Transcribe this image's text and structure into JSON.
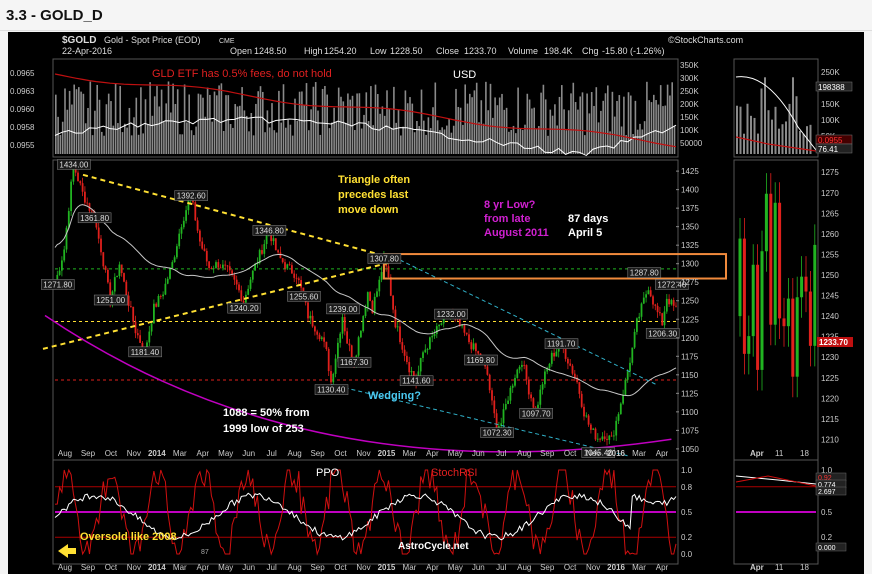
{
  "page_title": "3.3 - GOLD_D",
  "chart_data": {
    "type": "candlestick",
    "symbol": "$GOLD",
    "instrument": "Gold - Spot Price (EOD)",
    "exchange": "CME",
    "source": "©StockCharts.com",
    "date": "22-Apr-2016",
    "quote": {
      "open": "1248.50",
      "high": "1254.20",
      "low": "1228.50",
      "close": "1233.70",
      "volume": "198.4K",
      "chg": "-15.80 (-1.26%)"
    },
    "quote_labels": {
      "open": "Open",
      "high": "High",
      "low": "Low",
      "close": "Close",
      "volume": "Volume",
      "chg": "Chg"
    },
    "top_panel": {
      "label": "USD",
      "annotation": "GLD ETF has 0.5% fees, do not hold",
      "left_ticks": [
        "0.0965",
        "0.0963",
        "0.0960",
        "0.0958",
        "0.0955"
      ],
      "right_ticks": [
        "350K",
        "300K",
        "250K",
        "200K",
        "150K",
        "100K",
        "50000"
      ]
    },
    "price_axis": {
      "ylim": [
        1035,
        1440
      ],
      "ticks": [
        1050,
        1075,
        1100,
        1125,
        1150,
        1175,
        1200,
        1225,
        1250,
        1275,
        1300,
        1325,
        1350,
        1375,
        1400,
        1425
      ]
    },
    "months_axis": [
      "Aug",
      "Sep",
      "Oct",
      "Nov",
      "2014",
      "Mar",
      "Apr",
      "May",
      "Jun",
      "Jul",
      "Aug",
      "Sep",
      "Oct",
      "Nov",
      "2015",
      "Mar",
      "Apr",
      "May",
      "Jun",
      "Jul",
      "Aug",
      "Sep",
      "Oct",
      "Nov",
      "2016",
      "Mar",
      "Apr"
    ],
    "close_path": [
      [
        0,
        1272
      ],
      [
        4,
        1320
      ],
      [
        8,
        1434
      ],
      [
        12,
        1395
      ],
      [
        17,
        1362
      ],
      [
        20,
        1320
      ],
      [
        24,
        1251
      ],
      [
        28,
        1300
      ],
      [
        31,
        1260
      ],
      [
        35,
        1210
      ],
      [
        39,
        1181
      ],
      [
        43,
        1240
      ],
      [
        47,
        1262
      ],
      [
        51,
        1300
      ],
      [
        55,
        1355
      ],
      [
        59,
        1392
      ],
      [
        63,
        1330
      ],
      [
        67,
        1295
      ],
      [
        71,
        1300
      ],
      [
        75,
        1290
      ],
      [
        79,
        1270
      ],
      [
        82,
        1250
      ],
      [
        85,
        1280
      ],
      [
        89,
        1312
      ],
      [
        93,
        1345
      ],
      [
        97,
        1310
      ],
      [
        101,
        1295
      ],
      [
        105,
        1285
      ],
      [
        108,
        1255
      ],
      [
        110,
        1230
      ],
      [
        113,
        1215
      ],
      [
        116,
        1200
      ],
      [
        118,
        1180
      ],
      [
        120,
        1140
      ],
      [
        122,
        1175
      ],
      [
        125,
        1230
      ],
      [
        127,
        1195
      ],
      [
        130,
        1167
      ],
      [
        133,
        1215
      ],
      [
        136,
        1262
      ],
      [
        138,
        1240
      ],
      [
        141,
        1275
      ],
      [
        143,
        1307
      ],
      [
        145,
        1280
      ],
      [
        148,
        1220
      ],
      [
        151,
        1190
      ],
      [
        154,
        1160
      ],
      [
        157,
        1141
      ],
      [
        160,
        1180
      ],
      [
        164,
        1200
      ],
      [
        168,
        1220
      ],
      [
        172,
        1232
      ],
      [
        176,
        1215
      ],
      [
        180,
        1195
      ],
      [
        185,
        1172
      ],
      [
        188,
        1150
      ],
      [
        190,
        1110
      ],
      [
        192,
        1080
      ],
      [
        194,
        1085
      ],
      [
        197,
        1120
      ],
      [
        200,
        1150
      ],
      [
        203,
        1170
      ],
      [
        206,
        1130
      ],
      [
        209,
        1100
      ],
      [
        212,
        1140
      ],
      [
        216,
        1175
      ],
      [
        220,
        1192
      ],
      [
        223,
        1170
      ],
      [
        227,
        1140
      ],
      [
        230,
        1100
      ],
      [
        233,
        1075
      ],
      [
        236,
        1065
      ],
      [
        239,
        1070
      ],
      [
        242,
        1062
      ],
      [
        245,
        1100
      ],
      [
        248,
        1140
      ],
      [
        251,
        1185
      ],
      [
        253,
        1220
      ],
      [
        256,
        1250
      ],
      [
        258,
        1270
      ],
      [
        261,
        1240
      ],
      [
        264,
        1220
      ],
      [
        266,
        1255
      ],
      [
        268,
        1245
      ],
      [
        270,
        1238
      ]
    ],
    "annotations": [
      {
        "text": "1434.00",
        "x": 8,
        "y": 1434
      },
      {
        "text": "1361.80",
        "x": 17,
        "y": 1362
      },
      {
        "text": "1392.60",
        "x": 59,
        "y": 1392
      },
      {
        "text": "1346.80",
        "x": 93,
        "y": 1345
      },
      {
        "text": "1271.80",
        "x": 1,
        "y": 1272
      },
      {
        "text": "1251.00",
        "x": 24,
        "y": 1251
      },
      {
        "text": "1240.20",
        "x": 82,
        "y": 1240
      },
      {
        "text": "1181.40",
        "x": 39,
        "y": 1181
      },
      {
        "text": "1255.60",
        "x": 108,
        "y": 1256
      },
      {
        "text": "1239.00",
        "x": 125,
        "y": 1239
      },
      {
        "text": "1307.80",
        "x": 143,
        "y": 1307
      },
      {
        "text": "1232.00",
        "x": 172,
        "y": 1232
      },
      {
        "text": "1169.80",
        "x": 185,
        "y": 1170
      },
      {
        "text": "1191.70",
        "x": 220,
        "y": 1192
      },
      {
        "text": "1167.30",
        "x": 130,
        "y": 1167
      },
      {
        "text": "1141.60",
        "x": 157,
        "y": 1142
      },
      {
        "text": "1130.40",
        "x": 120,
        "y": 1130
      },
      {
        "text": "1097.70",
        "x": 209,
        "y": 1098
      },
      {
        "text": "1072.30",
        "x": 192,
        "y": 1072
      },
      {
        "text": "1045.40",
        "x": 236,
        "y": 1045
      },
      {
        "text": "1287.80",
        "x": 256,
        "y": 1288
      },
      {
        "text": "1272.40",
        "x": 268,
        "y": 1272
      },
      {
        "text": "1206.30",
        "x": 264,
        "y": 1206
      }
    ],
    "notes": {
      "triangle": [
        "Triangle often",
        "precedes last",
        "move down"
      ],
      "eightyr": [
        "8 yr Low?",
        "from late",
        "August 2011"
      ],
      "days": [
        "87 days",
        "April 5"
      ],
      "wedging": "Wedging?",
      "fifty": [
        "1088 = 50% from",
        "1999  low of 253"
      ]
    },
    "lower_panel": {
      "ppo_label": "PPO",
      "stoch_label": "StochRSI",
      "oversold": "Oversold like 2008",
      "site": "AstroCycle.net",
      "small_label": "87",
      "right_ticks": [
        "1.0",
        "0.8",
        "0.5",
        "0.2",
        "0.0"
      ]
    },
    "side_panel": {
      "top_ticks": [
        "250K",
        "200K",
        "150K",
        "100K",
        "50K"
      ],
      "top_labels": [
        "198388",
        "0.0955",
        "76.41"
      ],
      "price_ticks": [
        1210,
        1215,
        1220,
        1225,
        1230,
        1235,
        1240,
        1245,
        1250,
        1255,
        1260,
        1265,
        1270,
        1275
      ],
      "close_label": "1233.70",
      "months": [
        "Apr",
        "11",
        "18"
      ],
      "osc_ticks": [
        "1.0",
        "0.8",
        "0.5",
        "0.2"
      ],
      "osc_labels": [
        "0.92",
        "0.774",
        "2.697",
        "0.000"
      ]
    },
    "colors": {
      "bg": "#000000",
      "up": "#21b421",
      "down": "#e0201c",
      "ma": "#c8c8c8",
      "yellow": "#ffe033",
      "magenta": "#c000c0",
      "orange": "#f08a3c",
      "cyan": "#30b0c8"
    }
  }
}
